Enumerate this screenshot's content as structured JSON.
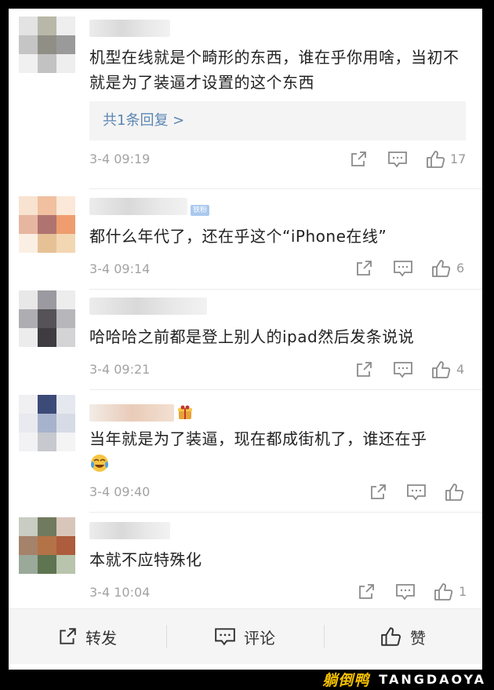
{
  "comments": [
    {
      "text": "机型在线就是个畸形的东西，谁在乎你用啥，当初不就是为了装逼才设置的这个东西",
      "reply_label": "共1条回复 >",
      "time": "3-4 09:19",
      "likes": "17"
    },
    {
      "badge": "铁粉",
      "text": "都什么年代了，还在乎这个“iPhone在线”",
      "time": "3-4 09:14",
      "likes": "6"
    },
    {
      "text": "哈哈哈之前都是登上别人的ipad然后发条说说",
      "time": "3-4 09:21",
      "likes": "4"
    },
    {
      "text": "当年就是为了装逼，现在都成街机了，谁还在乎",
      "time": "3-4 09:40",
      "likes": ""
    },
    {
      "text": "本就不应特殊化",
      "time": "3-4 10:04",
      "likes": "1"
    }
  ],
  "bottom_bar": {
    "repost_label": "转发",
    "comment_label": "评论",
    "like_label": "赞"
  },
  "watermark": {
    "cn": "躺倒鸭",
    "en": "TANGDAOYA"
  },
  "colors": {
    "link_blue": "#5b86b4",
    "time_gray": "#a3a3a3",
    "watermark_yellow": "#f5c000"
  }
}
